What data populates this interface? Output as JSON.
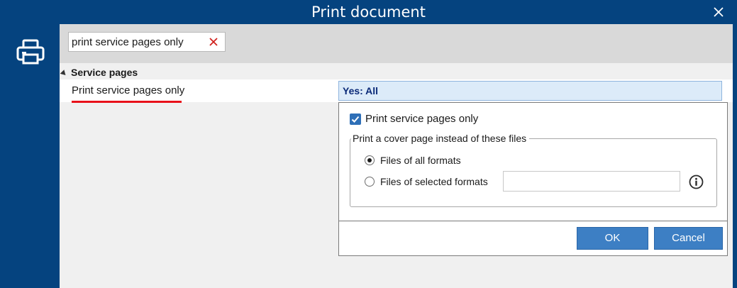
{
  "window": {
    "title": "Print document",
    "close_icon": "close-icon"
  },
  "sidebar": {
    "icon": "printer-icon"
  },
  "search": {
    "value": "print service pages only",
    "clear_icon": "clear-x-icon"
  },
  "group": {
    "label": "Service pages",
    "expand_icon": "collapse-triangle-icon"
  },
  "property": {
    "name": "Print service pages only",
    "value": "Yes: All"
  },
  "popup": {
    "checkbox": {
      "label": "Print service pages only",
      "checked": true
    },
    "fieldset_label": "Print a cover page instead of these files",
    "radio_all": {
      "label": "Files of all formats",
      "selected": true
    },
    "radio_selected": {
      "label": "Files of selected formats",
      "selected": false
    },
    "formats_input": {
      "value": ""
    },
    "info_icon": "info-icon",
    "ok_label": "OK",
    "cancel_label": "Cancel"
  },
  "colors": {
    "titlebar": "#05437f",
    "accent_button": "#3d7fc4",
    "value_highlight": "#dcebf9",
    "underline": "#e8111a"
  }
}
